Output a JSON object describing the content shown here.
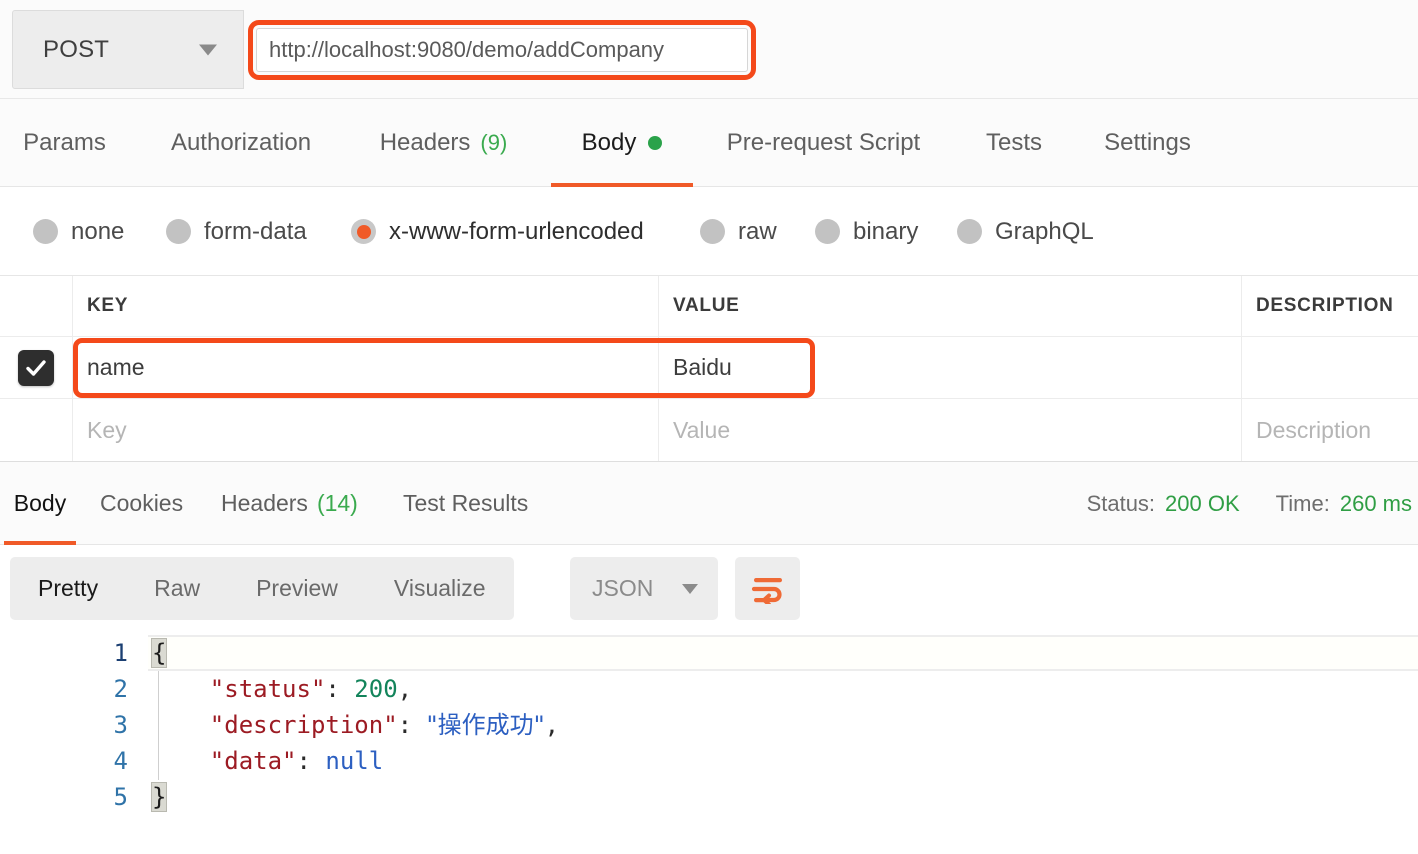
{
  "request_bar": {
    "method": "POST",
    "method_caret_icon": "chevron-down-icon",
    "url": "http://localhost:9080/demo/addCompany",
    "url_highlight_color": "#f4491a"
  },
  "request_tabs": [
    {
      "label": "Params",
      "count": "",
      "active": false,
      "has_dot": false
    },
    {
      "label": "Authorization",
      "count": "",
      "active": false,
      "has_dot": false
    },
    {
      "label": "Headers",
      "count": "(9)",
      "active": false,
      "has_dot": false
    },
    {
      "label": "Body",
      "count": "",
      "active": true,
      "has_dot": true
    },
    {
      "label": "Pre-request Script",
      "count": "",
      "active": false,
      "has_dot": false
    },
    {
      "label": "Tests",
      "count": "",
      "active": false,
      "has_dot": false
    },
    {
      "label": "Settings",
      "count": "",
      "active": false,
      "has_dot": false
    }
  ],
  "body_types": [
    {
      "label": "none",
      "selected": false
    },
    {
      "label": "form-data",
      "selected": false
    },
    {
      "label": "x-www-form-urlencoded",
      "selected": true
    },
    {
      "label": "raw",
      "selected": false
    },
    {
      "label": "binary",
      "selected": false
    },
    {
      "label": "GraphQL",
      "selected": false
    }
  ],
  "kv_table": {
    "headers": {
      "key": "KEY",
      "value": "VALUE",
      "description": "DESCRIPTION"
    },
    "rows": [
      {
        "checked": true,
        "key": "name",
        "value": "Baidu",
        "description": "",
        "highlighted": true
      },
      {
        "checked": false,
        "key": "Key",
        "value": "Value",
        "description": "Description",
        "placeholder": true
      }
    ]
  },
  "response_tabs": [
    {
      "label": "Body",
      "count": "",
      "active": true
    },
    {
      "label": "Cookies",
      "count": "",
      "active": false
    },
    {
      "label": "Headers",
      "count": "(14)",
      "active": false
    },
    {
      "label": "Test Results",
      "count": "",
      "active": false
    }
  ],
  "response_meta": {
    "status_label": "Status:",
    "status_value": "200 OK",
    "time_label": "Time:",
    "time_value": "260 ms",
    "status_color": "#2f9e44"
  },
  "response_toolbar": {
    "views": [
      {
        "label": "Pretty",
        "active": true
      },
      {
        "label": "Raw",
        "active": false
      },
      {
        "label": "Preview",
        "active": false
      },
      {
        "label": "Visualize",
        "active": false
      }
    ],
    "format": "JSON",
    "format_caret_icon": "chevron-down-icon",
    "wrap_button_icon": "word-wrap-icon"
  },
  "response_body": {
    "language": "json",
    "lines": [
      {
        "n": "1",
        "active": true
      },
      {
        "n": "2",
        "active": false
      },
      {
        "n": "3",
        "active": false
      },
      {
        "n": "4",
        "active": false
      },
      {
        "n": "5",
        "active": false
      }
    ],
    "tokens": {
      "open_brace": "{",
      "close_brace": "}",
      "k_status": "\"status\"",
      "v_status": "200",
      "k_description": "\"description\"",
      "v_description": "\"操作成功\"",
      "k_data": "\"data\"",
      "v_data": "null",
      "colon": ": ",
      "comma": ","
    }
  }
}
